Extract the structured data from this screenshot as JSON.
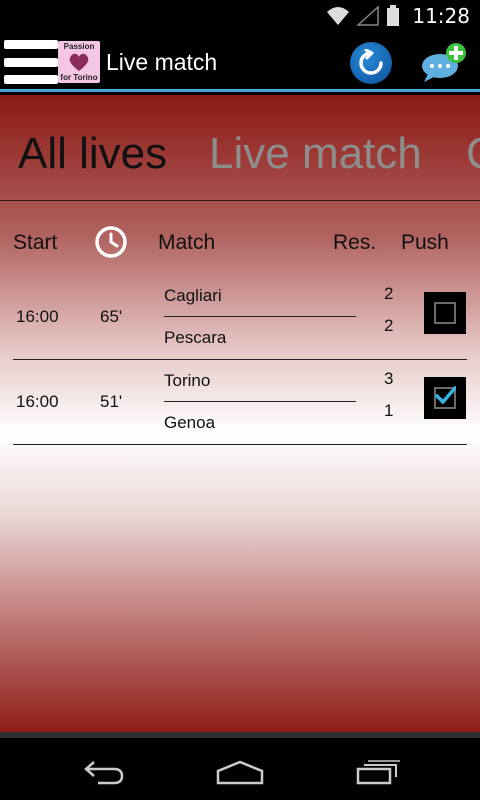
{
  "status_bar": {
    "time": "11:28"
  },
  "action_bar": {
    "logo_line1": "Passion",
    "logo_line2": "for Torino",
    "title": "Live match"
  },
  "tabs": [
    {
      "label": "All lives",
      "active": true
    },
    {
      "label": "Live match",
      "active": false
    },
    {
      "label": "C",
      "active": false
    }
  ],
  "table": {
    "headers": {
      "start": "Start",
      "match": "Match",
      "result": "Res.",
      "push": "Push"
    },
    "rows": [
      {
        "start": "16:00",
        "minute": "65'",
        "home": "Cagliari",
        "away": "Pescara",
        "home_score": "2",
        "away_score": "2",
        "push": false
      },
      {
        "start": "16:00",
        "minute": "51'",
        "home": "Torino",
        "away": "Genoa",
        "home_score": "3",
        "away_score": "1",
        "push": true
      }
    ]
  },
  "icons": {
    "menu": "hamburger-menu-icon",
    "refresh": "refresh-icon",
    "chat_add": "chat-add-icon",
    "clock": "clock-icon",
    "back": "back-icon",
    "home": "home-icon",
    "recents": "recents-icon"
  },
  "colors": {
    "accent": "#4aa3d8",
    "header_top": "#8c1a15",
    "checkbox_check": "#33b5e5"
  }
}
